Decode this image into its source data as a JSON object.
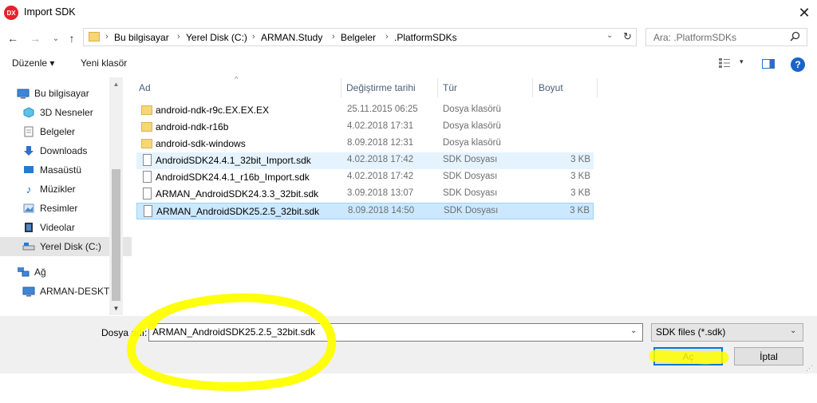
{
  "window": {
    "title": "Import SDK",
    "app_icon_text": "DX",
    "close_symbol": "✕"
  },
  "nav_buttons": {
    "back": "←",
    "forward": "→",
    "recent": "⌄",
    "up": "↑"
  },
  "address_bar": {
    "breadcrumbs": [
      "Bu bilgisayar",
      "Yerel Disk (C:)",
      "ARMAN.Study",
      "Belgeler",
      ".PlatformSDKs"
    ],
    "separator": "›",
    "dropdown_symbol": "⌄",
    "refresh_symbol": "↻"
  },
  "search": {
    "placeholder": "Ara: .PlatformSDKs",
    "icon": "search-icon"
  },
  "toolbar": {
    "organize_label": "Düzenle ▾",
    "new_folder_label": "Yeni klasör",
    "view_dropdown_symbol": "▾",
    "help_symbol": "?"
  },
  "nav_pane": {
    "items": [
      {
        "label": "Bu bilgisayar",
        "icon": "computer-icon"
      },
      {
        "label": "3D Nesneler",
        "icon": "3d-objects-icon"
      },
      {
        "label": "Belgeler",
        "icon": "documents-icon"
      },
      {
        "label": "Downloads",
        "icon": "downloads-icon"
      },
      {
        "label": "Masaüstü",
        "icon": "desktop-icon"
      },
      {
        "label": "Müzikler",
        "icon": "music-icon"
      },
      {
        "label": "Resimler",
        "icon": "pictures-icon"
      },
      {
        "label": "Videolar",
        "icon": "videos-icon"
      },
      {
        "label": "Yerel Disk (C:)",
        "icon": "drive-icon"
      },
      {
        "label": "Ağ",
        "icon": "network-icon"
      },
      {
        "label": "ARMAN-DESKTOP",
        "icon": "computer-icon"
      }
    ],
    "scroll_up_symbol": "▲",
    "scroll_down_symbol": "▼"
  },
  "file_list": {
    "columns": {
      "name": "Ad",
      "date": "Değiştirme tarihi",
      "type": "Tür",
      "size": "Boyut"
    },
    "sort_symbol": "^",
    "rows": [
      {
        "name": "android-ndk-r9c.EX.EX.EX",
        "date": "25.11.2015 06:25",
        "type": "Dosya klasörü",
        "size": "",
        "kind": "folder"
      },
      {
        "name": "android-ndk-r16b",
        "date": "4.02.2018 17:31",
        "type": "Dosya klasörü",
        "size": "",
        "kind": "folder"
      },
      {
        "name": "android-sdk-windows",
        "date": "8.09.2018 12:31",
        "type": "Dosya klasörü",
        "size": "",
        "kind": "folder"
      },
      {
        "name": "AndroidSDK24.4.1_32bit_Import.sdk",
        "date": "4.02.2018 17:42",
        "type": "SDK Dosyası",
        "size": "3 KB",
        "kind": "file"
      },
      {
        "name": "AndroidSDK24.4.1_r16b_Import.sdk",
        "date": "4.02.2018 17:42",
        "type": "SDK Dosyası",
        "size": "3 KB",
        "kind": "file"
      },
      {
        "name": "ARMAN_AndroidSDK24.3.3_32bit.sdk",
        "date": "3.09.2018 13:07",
        "type": "SDK Dosyası",
        "size": "3 KB",
        "kind": "file"
      },
      {
        "name": "ARMAN_AndroidSDK25.2.5_32bit.sdk",
        "date": "8.09.2018 14:50",
        "type": "SDK Dosyası",
        "size": "3 KB",
        "kind": "file"
      }
    ],
    "hover_index": 3,
    "selected_index": 6
  },
  "bottom": {
    "filename_label": "Dosya adı:",
    "filename_value": "ARMAN_AndroidSDK25.2.5_32bit.sdk",
    "filename_dropdown_symbol": "⌄",
    "filetype_value": "SDK files (*.sdk)",
    "filetype_dropdown_symbol": "⌄",
    "open_label": "Aç",
    "cancel_label": "İptal",
    "resize_symbol": "⋰"
  },
  "colors": {
    "highlight_stroke": "#ffff00",
    "selection_bg": "#cce8ff",
    "hover_bg": "#e5f3ff",
    "accent": "#0078d7"
  }
}
